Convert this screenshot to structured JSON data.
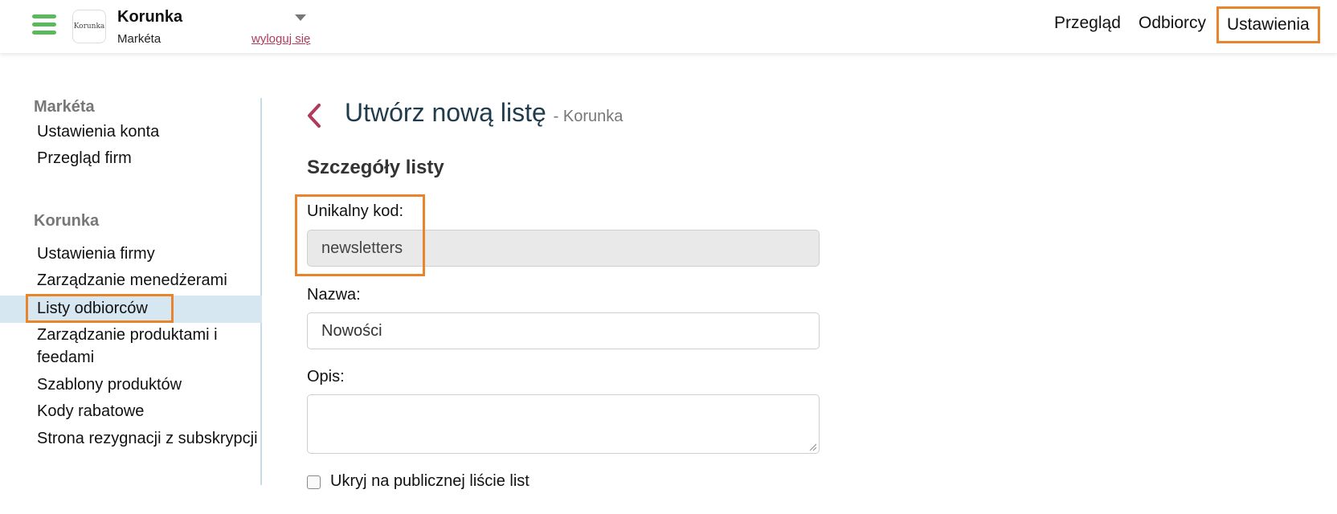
{
  "header": {
    "logo_text": "Korunka",
    "company": "Korunka",
    "user": "Markéta",
    "logout": "wyloguj się",
    "nav": [
      "Przegląd",
      "Odbiorcy",
      "Ustawienia"
    ]
  },
  "sidebar": {
    "user_section": "Markéta",
    "user_items": [
      "Ustawienia konta",
      "Przegląd firm"
    ],
    "company_section": "Korunka",
    "company_items": [
      "Ustawienia firmy",
      "Zarządzanie menedżerami",
      "Listy odbiorców",
      "Zarządzanie produktami i",
      "feedami",
      "Szablony produktów",
      "Kody rabatowe",
      "Strona rezygnacji z subskrypcji"
    ],
    "active_item": "Listy odbiorców"
  },
  "main": {
    "title": "Utwórz nową listę",
    "subtitle": "- Korunka",
    "section": "Szczegóły listy",
    "code_label": "Unikalny kod:",
    "code_value": "newsletters",
    "name_label": "Nazwa:",
    "name_value": "Nowości",
    "desc_label": "Opis:",
    "desc_value": "",
    "hide_label": "Ukryj na publicznej liście list",
    "hide_checked": false
  },
  "colors": {
    "accent_green": "#5cb85c",
    "highlight_orange": "#e8842c",
    "title": "#1f3c4d",
    "link": "#b03a5b",
    "active_row": "#d6e7f2"
  }
}
